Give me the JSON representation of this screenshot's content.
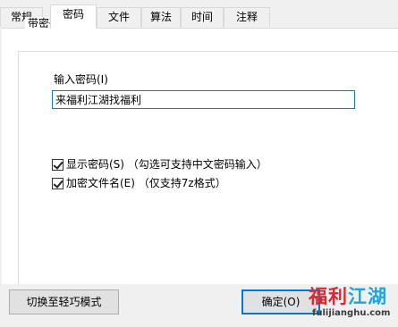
{
  "tabs": [
    {
      "label": "常规",
      "active": false
    },
    {
      "label": "密码",
      "active": true
    },
    {
      "label": "文件",
      "active": false
    },
    {
      "label": "算法",
      "active": false
    },
    {
      "label": "时间",
      "active": false
    },
    {
      "label": "注释",
      "active": false
    }
  ],
  "group": {
    "title": "带密码压缩",
    "password_label": "输入密码(I)",
    "password_value": "来福利江湖找福利",
    "show_password": {
      "label": "显示密码(S) （勾选可支持中文密码输入）",
      "checked": true
    },
    "encrypt_filenames": {
      "label": "加密文件名(E) （仅支持7z格式）",
      "checked": true
    }
  },
  "buttons": {
    "light_mode": "切换至轻巧模式",
    "ok": "确定(O)"
  },
  "watermark": {
    "title_a": "福利",
    "title_b": "江湖",
    "url": "fulijianghu.com"
  }
}
